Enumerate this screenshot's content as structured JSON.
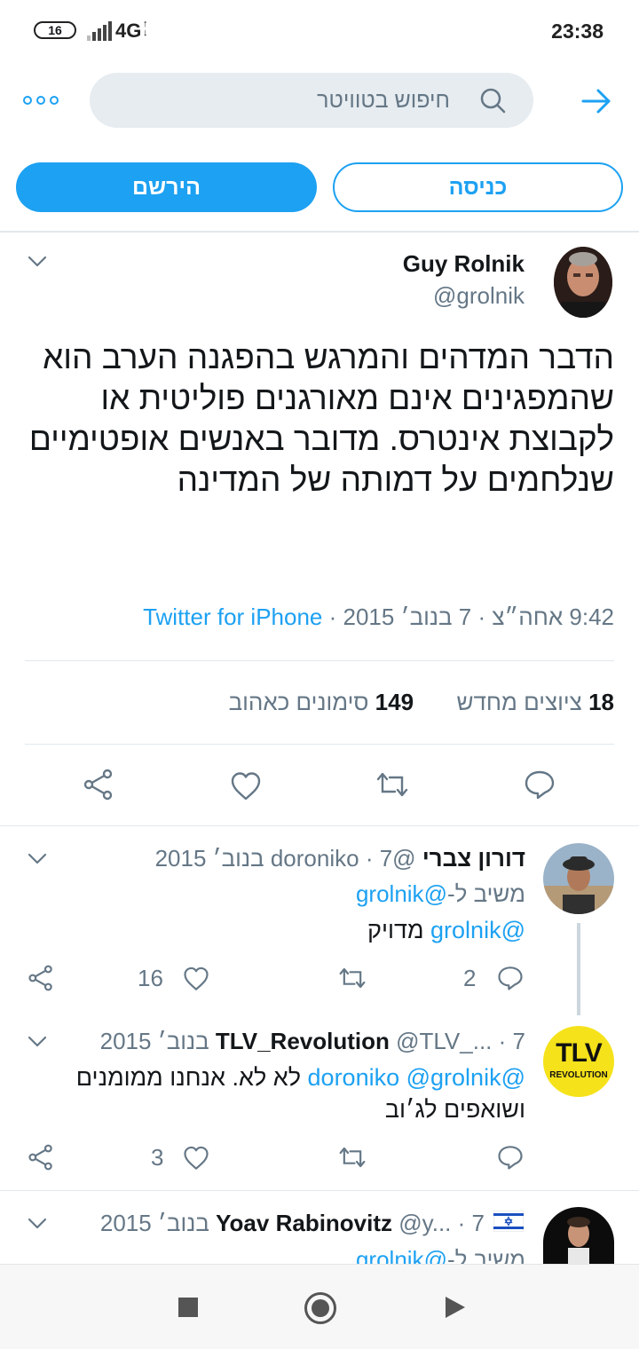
{
  "status_bar": {
    "battery": "16",
    "network": "4G",
    "time": "23:38"
  },
  "top_bar": {
    "search_placeholder": "חיפוש בטוויטר"
  },
  "auth": {
    "signup_label": "הירשם",
    "login_label": "כניסה"
  },
  "main_tweet": {
    "name": "Guy Rolnik",
    "handle": "@grolnik",
    "text": "הדבר המדהים והמרגש בהפגנה הערב הוא שהמפגינים אינם מאורגנים פוליטית או לקבוצת אינטרס. מדובר באנשים אופטימיים שנלחמים על דמותה של המדינה",
    "time": "9:42 אחה״צ",
    "date": "7 בנוב׳ 2015",
    "source": "Twitter for iPhone",
    "retweets_count": "18",
    "retweets_label": "ציוצים מחדש",
    "likes_count": "149",
    "likes_label": "סימונים כאהוב"
  },
  "replies": [
    {
      "name": "דורון צברי",
      "handle": "@doroniko",
      "date": "7 בנוב׳ 2015",
      "replying_prefix": "משיב ל-",
      "replying_handle": "@grolnik",
      "mention": "@grolnik",
      "text": "מדויק",
      "reply_count": "2",
      "like_count": "16"
    },
    {
      "name": "TLV_Revolution",
      "handle": "@TLV_...",
      "date": "7 בנוב׳ 2015",
      "mention1": "@doroniko",
      "mention2": "@grolnik",
      "text": "לא לא. אנחנו ממומנים ושואפים לג׳וב",
      "like_count": "3",
      "avatar_text_top": "TLV",
      "avatar_text_bottom": "REVOLUTION"
    },
    {
      "name": "Yoav Rabinovitz",
      "handle": "@y...",
      "date": "7 בנוב׳ 2015",
      "replying_prefix": "משיב ל-",
      "replying_handle": "@grolnik"
    }
  ],
  "colors": {
    "accent": "#1da1f2",
    "secondary_text": "#657786",
    "divider": "#e1e8ed"
  }
}
